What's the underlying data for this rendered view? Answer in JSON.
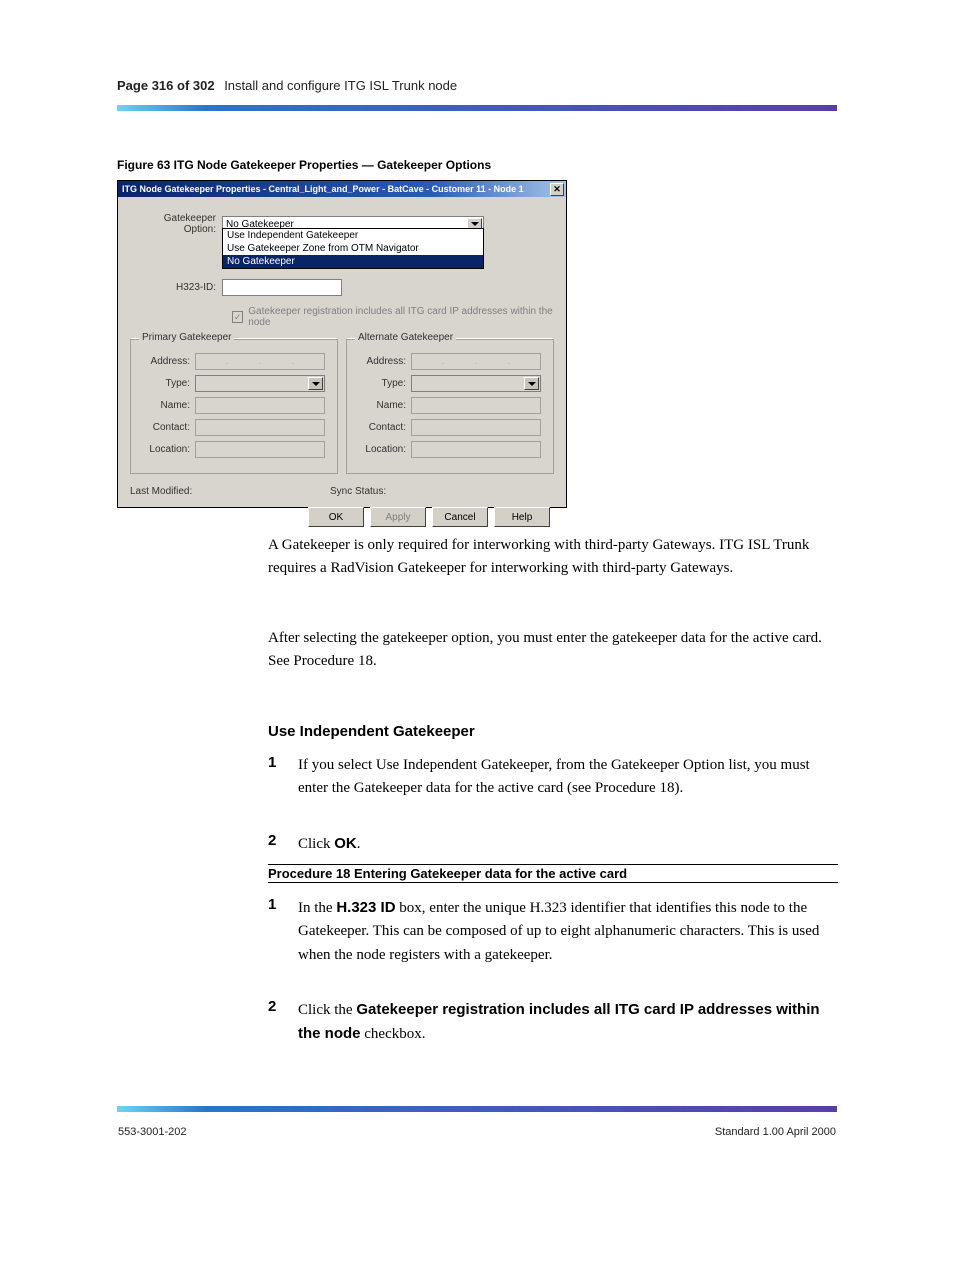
{
  "page": {
    "number": "316",
    "chapter": "Install and configure ITG ISL Trunk node",
    "figure_label": "Figure 63   ITG Node Gatekeeper Properties — Gatekeeper Options",
    "footer_left": "553-3001-202",
    "footer_right": "Standard 1.00   April 2000"
  },
  "dialog": {
    "title": "ITG Node Gatekeeper Properties - Central_Light_and_Power - BatCave - Customer 11 - Node 1",
    "labels": {
      "gatekeeper_option": "Gatekeeper Option:",
      "h323id": "H323-ID:",
      "checkbox": "Gatekeeper registration includes all ITG card IP addresses within the node",
      "primary": "Primary Gatekeeper",
      "alternate": "Alternate Gatekeeper",
      "address": "Address:",
      "type": "Type:",
      "name": "Name:",
      "contact": "Contact:",
      "location": "Location:",
      "last_modified": "Last Modified:",
      "sync_status": "Sync Status:"
    },
    "gatekeeper_value": "No Gatekeeper",
    "options": {
      "opt1": "Use Independent Gatekeeper",
      "opt2": "Use Gatekeeper Zone from OTM Navigator",
      "opt3": "No Gatekeeper"
    },
    "buttons": {
      "ok": "OK",
      "apply": "Apply",
      "cancel": "Cancel",
      "help": "Help"
    }
  },
  "text": {
    "para1": "A Gatekeeper is only required for interworking with third-party Gateways. ITG ISL Trunk requires a RadVision Gatekeeper for interworking with third-party Gateways.",
    "para2": "After selecting the gatekeeper option, you must enter the gatekeeper data for the active card. See Procedure 18.",
    "heading": "Use Independent Gatekeeper",
    "step1": "If you select Use Independent Gatekeeper, from the Gatekeeper Option list, you must enter the Gatekeeper data for the active card (see Procedure 18).",
    "step2": "Click OK.",
    "proc_title": "Procedure 18   Entering Gatekeeper data for the active card",
    "p18_step1_a": "In the ",
    "p18_step1_b": "H.323 ID",
    "p18_step1_c": " box, enter the unique H.323 identifier that identifies this node to the Gatekeeper. This can be composed of up to eight alphanumeric characters. This is used when the node registers with a gatekeeper.",
    "p18_step2_a": "Click the ",
    "p18_step2_b": "Gatekeeper registration includes all ITG card IP addresses within the node",
    "p18_step2_c": " checkbox."
  }
}
